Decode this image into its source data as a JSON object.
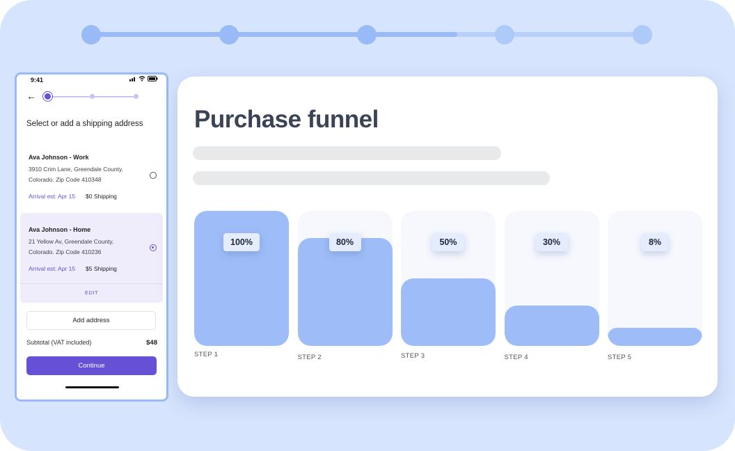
{
  "mobile": {
    "status_time": "9:41",
    "heading": "Select or add a shipping address",
    "addresses": [
      {
        "name": "Ava Johnson - Work",
        "line1": "3910 Crim Lane, Greendale County,",
        "line2": "Colorado. Zip Code 410348",
        "arrival": "Arrival est: Apr 15",
        "shipping": "$0 Shipping",
        "selected": false
      },
      {
        "name": "Ava Johnson - Home",
        "line1": "21 Yellow Av, Greendale County,",
        "line2": "Colorado. Zip Code 410236",
        "arrival": "Arrival est: Apr 15",
        "shipping": "$5 Shipping",
        "selected": true
      }
    ],
    "edit_label": "EDIT",
    "add_address_label": "Add address",
    "subtotal_label": "Subtotal (VAT included)",
    "subtotal_value": "$48",
    "continue_label": "Continue"
  },
  "funnel_card": {
    "title": "Purchase funnel",
    "steps": [
      {
        "label": "STEP 1",
        "percent_text": "100%"
      },
      {
        "label": "STEP 2",
        "percent_text": "80%"
      },
      {
        "label": "STEP 3",
        "percent_text": "50%"
      },
      {
        "label": "STEP 4",
        "percent_text": "30%"
      },
      {
        "label": "STEP 5",
        "percent_text": "8%"
      }
    ]
  },
  "colors": {
    "accent": "#6650d6",
    "bar_fill": "#9dbcf8",
    "background": "#d6e4fd"
  },
  "chart_data": {
    "type": "bar",
    "categories": [
      "STEP 1",
      "STEP 2",
      "STEP 3",
      "STEP 4",
      "STEP 5"
    ],
    "values": [
      100,
      80,
      50,
      30,
      8
    ],
    "title": "Purchase funnel",
    "ylim": [
      0,
      100
    ],
    "grid": false
  }
}
